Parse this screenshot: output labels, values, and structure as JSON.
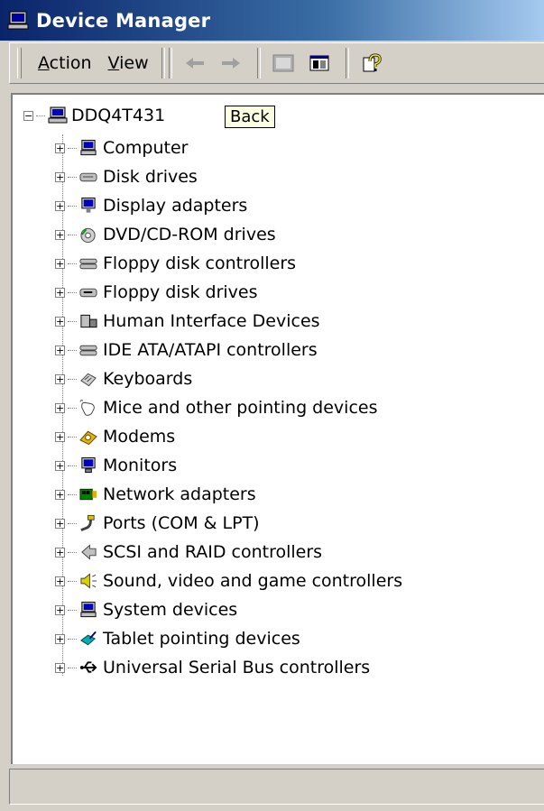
{
  "window": {
    "title": "Device Manager"
  },
  "tooltip": "Back",
  "menu": {
    "action": "Action",
    "action_mnemonic": "A",
    "action_rest": "ction",
    "view": "View",
    "view_mnemonic": "V",
    "view_rest": "iew"
  },
  "toolbar": {
    "buttons": [
      "back-arrow-icon",
      "forward-arrow-icon",
      "properties-icon",
      "show-hide-tree-icon",
      "help-icon"
    ]
  },
  "tree": {
    "root": "DDQ4T431",
    "items": [
      {
        "label": "Computer",
        "icon": "computer-icon"
      },
      {
        "label": "Disk drives",
        "icon": "disk-drive-icon"
      },
      {
        "label": "Display adapters",
        "icon": "display-adapter-icon"
      },
      {
        "label": "DVD/CD-ROM drives",
        "icon": "dvd-drive-icon"
      },
      {
        "label": "Floppy disk controllers",
        "icon": "floppy-controller-icon"
      },
      {
        "label": "Floppy disk drives",
        "icon": "floppy-drive-icon"
      },
      {
        "label": "Human Interface Devices",
        "icon": "hid-icon"
      },
      {
        "label": "IDE ATA/ATAPI controllers",
        "icon": "ide-controller-icon"
      },
      {
        "label": "Keyboards",
        "icon": "keyboard-icon"
      },
      {
        "label": "Mice and other pointing devices",
        "icon": "mouse-icon"
      },
      {
        "label": "Modems",
        "icon": "modem-icon"
      },
      {
        "label": "Monitors",
        "icon": "monitor-icon"
      },
      {
        "label": "Network adapters",
        "icon": "network-adapter-icon"
      },
      {
        "label": "Ports (COM & LPT)",
        "icon": "port-icon"
      },
      {
        "label": "SCSI and RAID controllers",
        "icon": "scsi-icon"
      },
      {
        "label": "Sound, video and game controllers",
        "icon": "sound-icon"
      },
      {
        "label": "System devices",
        "icon": "system-devices-icon"
      },
      {
        "label": "Tablet pointing devices",
        "icon": "tablet-icon"
      },
      {
        "label": "Universal Serial Bus controllers",
        "icon": "usb-icon"
      }
    ]
  }
}
